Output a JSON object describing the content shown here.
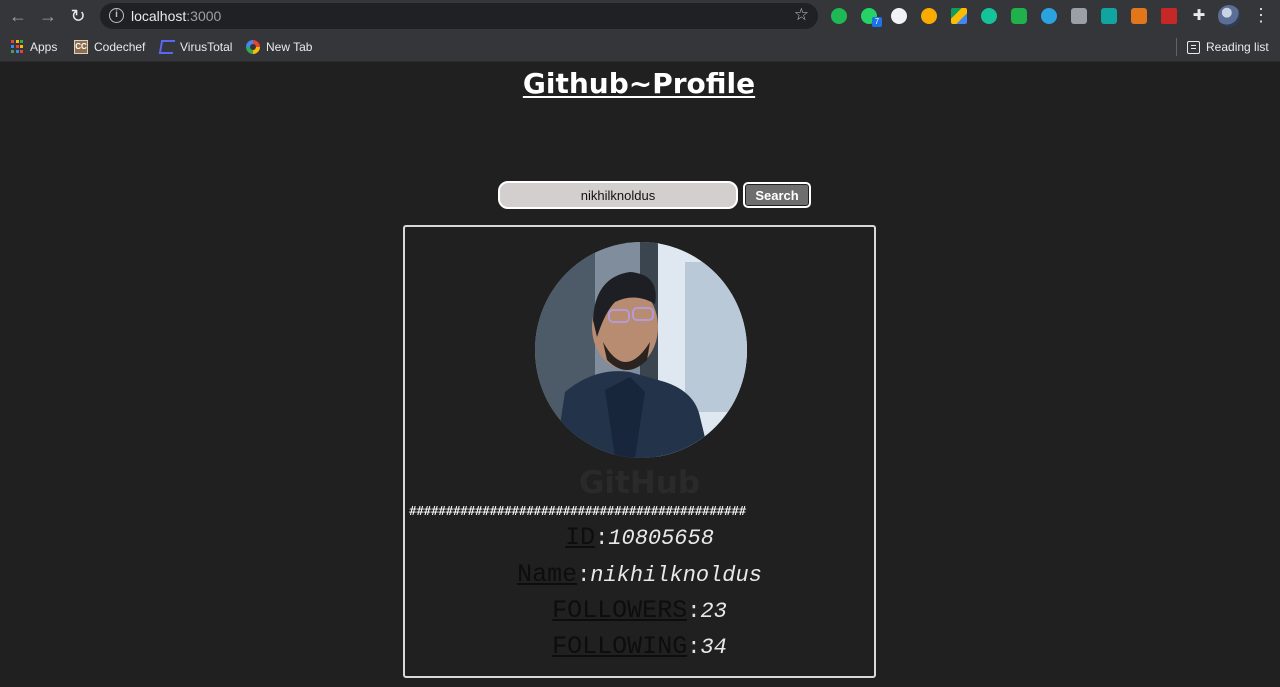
{
  "browser": {
    "url_host": "localhost",
    "url_port": ":3000",
    "extension_badge": "7",
    "bookmarks": [
      {
        "label": "Apps"
      },
      {
        "label": "Codechef"
      },
      {
        "label": "VirusTotal"
      },
      {
        "label": "New Tab"
      }
    ],
    "reading_list": "Reading list"
  },
  "page": {
    "title": "Github~Profile",
    "search": {
      "value": "nikhilknoldus",
      "button_label": "Search"
    },
    "profile": {
      "company": "GitHub",
      "divider": "##############################################",
      "id_label": "ID",
      "id_value": "10805658",
      "name_label": "Name",
      "name_value": "nikhilknoldus",
      "followers_label": "FOLLOWERS",
      "followers_value": "23",
      "following_label": "FOLLOWING",
      "following_value": "34",
      "separator": ":"
    }
  },
  "colors": {
    "background": "#202020",
    "chrome": "#35363a",
    "input_bg": "#d3cfcf",
    "button_bg": "#6e6e6e"
  }
}
